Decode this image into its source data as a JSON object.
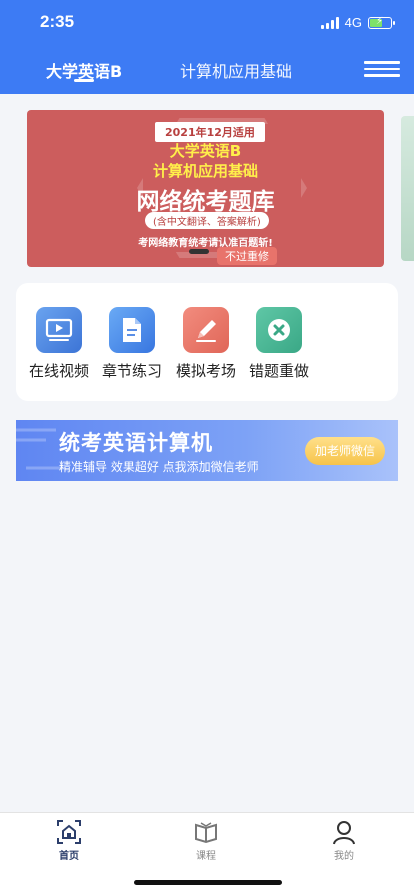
{
  "status_bar": {
    "time": "2:35",
    "network": "4G"
  },
  "top_tabs": {
    "active": "大学英语B",
    "second": "计算机应用基础"
  },
  "banner": {
    "date_label": "2021年12月适用",
    "title_line1": "大学英语B",
    "title_line2": "计算机应用基础",
    "title_line3": "网络统考题库",
    "subtitle": "(含中文翻译、答案解析)",
    "tagline": "考网络教育统考请认准百题斩!",
    "tag": "不过重修"
  },
  "quick_access": [
    {
      "label": "在线视频",
      "icon": "video-icon"
    },
    {
      "label": "章节练习",
      "icon": "document-icon"
    },
    {
      "label": "模拟考场",
      "icon": "pencil-icon"
    },
    {
      "label": "错题重做",
      "icon": "cross-icon"
    }
  ],
  "promo": {
    "title": "统考英语计算机",
    "subtitle": "精准辅导 效果超好 点我添加微信老师",
    "button": "加老师微信"
  },
  "tabbar": [
    {
      "label": "首页",
      "icon": "home-icon",
      "active": true
    },
    {
      "label": "课程",
      "icon": "book-icon",
      "active": false
    },
    {
      "label": "我的",
      "icon": "user-icon",
      "active": false
    }
  ],
  "colors": {
    "primary": "#3d7bf4",
    "banner_bg": "#cc5d5d",
    "tab_active": "#2c3e6b"
  }
}
